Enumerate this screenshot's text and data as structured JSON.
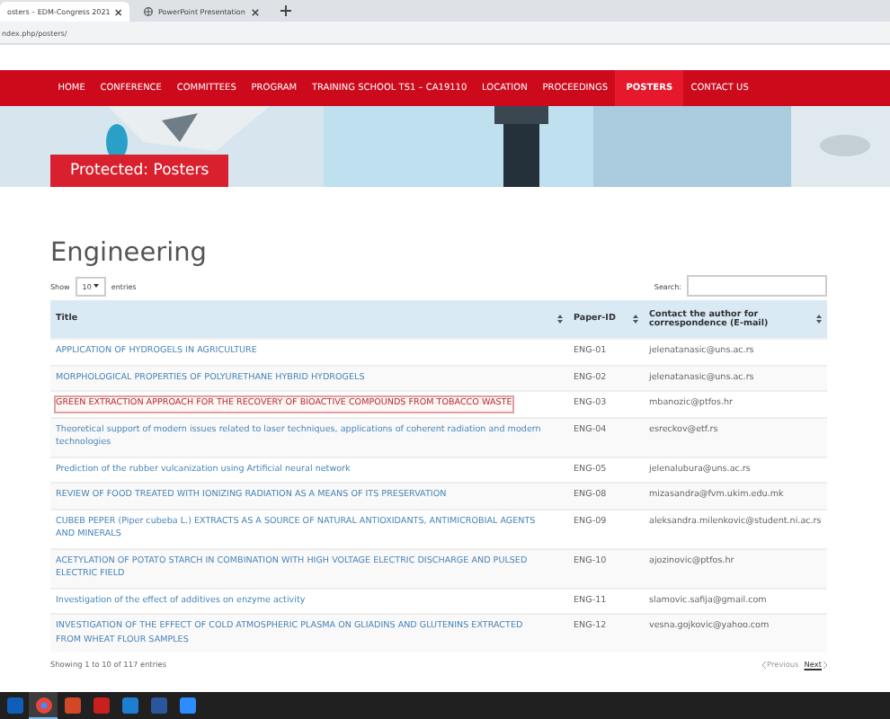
{
  "browser": {
    "tabs": [
      {
        "label": "osters – EDM-Congress 2021",
        "selected": true
      },
      {
        "label": "PowerPoint Presentation",
        "selected": false
      }
    ],
    "address": "ndex.php/posters/"
  },
  "nav": [
    {
      "label": "HOME",
      "selected": false
    },
    {
      "label": "CONFERENCE",
      "selected": false
    },
    {
      "label": "COMMITTEES",
      "selected": false
    },
    {
      "label": "PROGRAM",
      "selected": false
    },
    {
      "label": "TRAINING SCHOOL TS1 – CA19110",
      "selected": false
    },
    {
      "label": "LOCATION",
      "selected": false
    },
    {
      "label": "PROCEEDINGS",
      "selected": false
    },
    {
      "label": "POSTERS",
      "selected": true
    },
    {
      "label": "CONTACT US",
      "selected": false
    }
  ],
  "hero": {
    "kind": "picture",
    "title": "Protected: Posters"
  },
  "section_title": "Engineering",
  "length_control": {
    "before": "Show",
    "value": "10",
    "after": "entries"
  },
  "search": {
    "label": "Search:"
  },
  "table": {
    "columns": [
      "Title",
      "Paper-ID",
      "Contact the author for correspondence (E-mail)"
    ],
    "rows": [
      {
        "title": "APPLICATION OF HYDROGELS IN AGRICULTURE",
        "id": "ENG-01",
        "email": "jelenatanasic@uns.ac.rs",
        "highlighted": false
      },
      {
        "title": "MORPHOLOGICAL PROPERTIES OF POLYURETHANE HYBRID HYDROGELS",
        "id": "ENG-02",
        "email": "jelenatanasic@uns.ac.rs",
        "highlighted": false
      },
      {
        "title": "GREEN EXTRACTION APPROACH FOR THE RECOVERY OF BIOACTIVE COMPOUNDS FROM TOBACCO WASTE",
        "id": "ENG-03",
        "email": "mbanozic@ptfos.hr",
        "highlighted": true
      },
      {
        "title": "Theoretical support of modern issues related to laser techniques, applications of coherent radiation and modern technologies",
        "id": "ENG-04",
        "email": "esreckov@etf.rs",
        "highlighted": false
      },
      {
        "title": "Prediction of the rubber vulcanization using Artificial neural network",
        "id": "ENG-05",
        "email": "jelenalubura@uns.ac.rs",
        "highlighted": false
      },
      {
        "title": "REVIEW OF FOOD TREATED WITH IONIZING RADIATION AS A MEANS OF ITS PRESERVATION",
        "id": "ENG-08",
        "email": "mizasandra@fvm.ukim.edu.mk",
        "highlighted": false
      },
      {
        "title": "CUBEB PEPER (Piper cubeba L.) EXTRACTS AS A SOURCE OF NATURAL ANTIOXIDANTS, ANTIMICROBIAL AGENTS AND MINERALS",
        "id": "ENG-09",
        "email": "aleksandra.milenkovic@student.ni.ac.rs",
        "highlighted": false
      },
      {
        "title": "ACETYLATION OF POTATO STARCH IN COMBINATION WITH HIGH VOLTAGE ELECTRIC DISCHARGE AND PULSED ELECTRIC FIELD",
        "id": "ENG-10",
        "email": "ajozinovic@ptfos.hr",
        "highlighted": false
      },
      {
        "title": "Investigation of the effect of additives on enzyme activity",
        "id": "ENG-11",
        "email": "slamovic.safija@gmail.com",
        "highlighted": false
      },
      {
        "title": "INVESTIGATION OF THE EFFECT OF COLD ATMOSPHERIC PLASMA ON GLIADINS AND GLUTENINS EXTRACTED FROM WHEAT FLOUR SAMPLES",
        "id": "ENG-12",
        "email": "vesna.gojkovic@yahoo.com",
        "highlighted": false
      }
    ]
  },
  "info": "Showing 1 to 10 of 117 entries",
  "pager": {
    "previous": "Previous",
    "next": "Next"
  },
  "taskbar": [
    {
      "kind": "mail",
      "color": "#0f5fb8",
      "selected": false
    },
    {
      "kind": "browser",
      "color": "#e8453c",
      "selected": true
    },
    {
      "kind": "slides",
      "color": "#d24726",
      "selected": false
    },
    {
      "kind": "pdf",
      "color": "#c7201d",
      "selected": false
    },
    {
      "kind": "photos",
      "color": "#1e7fd0",
      "selected": false
    },
    {
      "kind": "doc",
      "color": "#2b579a",
      "selected": false
    },
    {
      "kind": "video",
      "color": "#2d8cff",
      "selected": false
    }
  ]
}
